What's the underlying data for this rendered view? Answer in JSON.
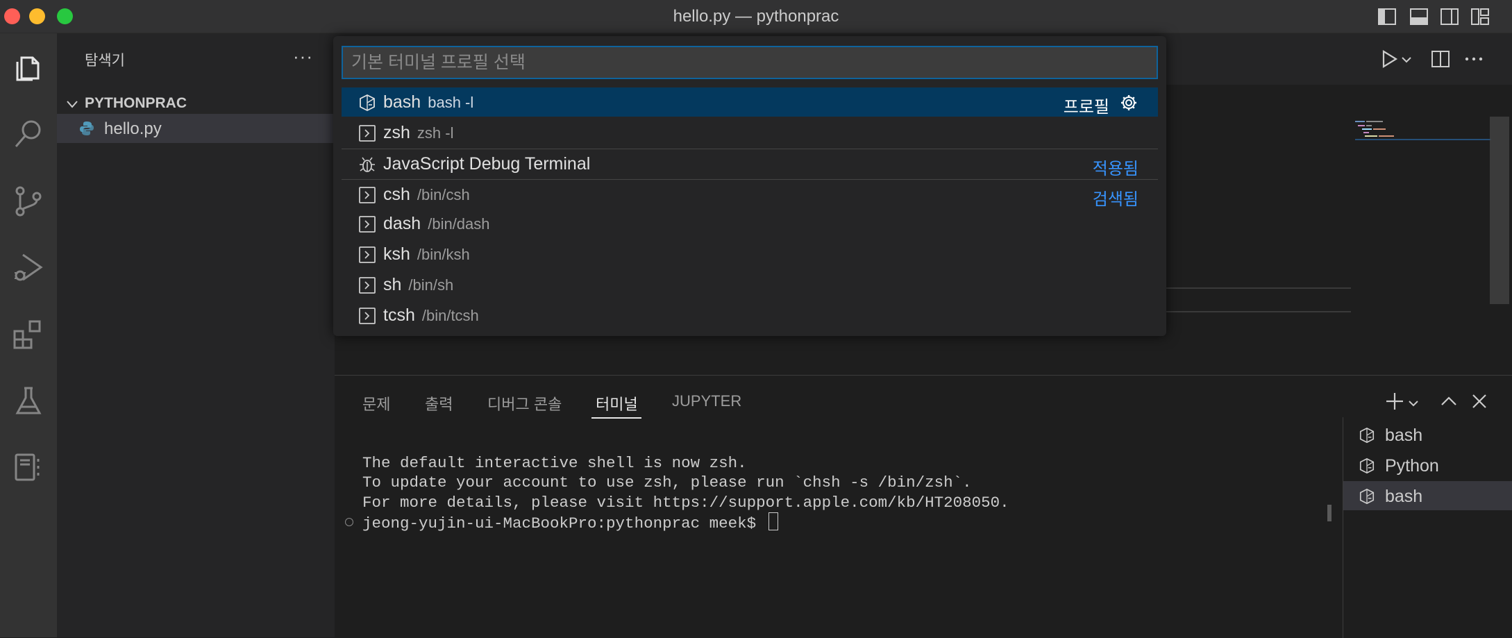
{
  "window": {
    "title": "hello.py — pythonprac"
  },
  "sidebar": {
    "title": "탐색기",
    "more": "···",
    "folder": "PYTHONPRAC",
    "file": "hello.py"
  },
  "quickpick": {
    "placeholder": "기본 터미널 프로필 선택",
    "items": [
      {
        "name": "bash",
        "desc": "bash -l",
        "right": "프로필"
      },
      {
        "name": "zsh",
        "desc": "zsh -l",
        "right": ""
      },
      {
        "name": "JavaScript Debug Terminal",
        "desc": "",
        "right": "적용됨"
      },
      {
        "name": "csh",
        "desc": "/bin/csh",
        "right": "검색됨"
      },
      {
        "name": "dash",
        "desc": "/bin/dash",
        "right": ""
      },
      {
        "name": "ksh",
        "desc": "/bin/ksh",
        "right": ""
      },
      {
        "name": "sh",
        "desc": "/bin/sh",
        "right": ""
      },
      {
        "name": "tcsh",
        "desc": "/bin/tcsh",
        "right": ""
      }
    ]
  },
  "panel": {
    "tabs": [
      "문제",
      "출력",
      "디버그 콘솔",
      "터미널",
      "JUPYTER"
    ],
    "active_tab": "터미널"
  },
  "terminal": {
    "lines": [
      "The default interactive shell is now zsh.",
      "To update your account to use zsh, please run `chsh -s /bin/zsh`.",
      "For more details, please visit https://support.apple.com/kb/HT208050."
    ],
    "prompt": "jeong-yujin-ui-MacBookPro:pythonprac meek$ "
  },
  "terminal_list": [
    "bash",
    "Python",
    "bash"
  ],
  "colors": {
    "accent": "#0e639c",
    "selection": "#04395e",
    "link": "#3794ff"
  }
}
